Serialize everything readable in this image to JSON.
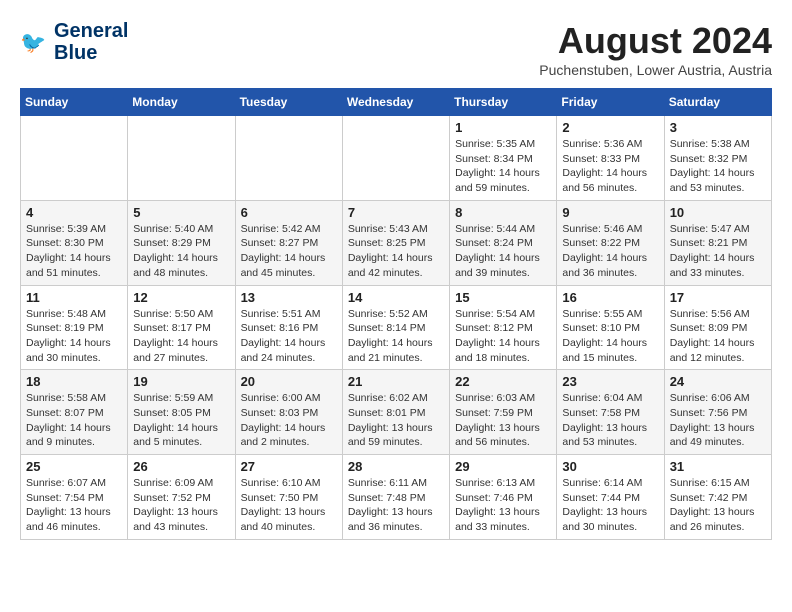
{
  "header": {
    "logo_line1": "General",
    "logo_line2": "Blue",
    "month_year": "August 2024",
    "location": "Puchenstuben, Lower Austria, Austria"
  },
  "days_of_week": [
    "Sunday",
    "Monday",
    "Tuesday",
    "Wednesday",
    "Thursday",
    "Friday",
    "Saturday"
  ],
  "weeks": [
    [
      {
        "day": "",
        "info": ""
      },
      {
        "day": "",
        "info": ""
      },
      {
        "day": "",
        "info": ""
      },
      {
        "day": "",
        "info": ""
      },
      {
        "day": "1",
        "info": "Sunrise: 5:35 AM\nSunset: 8:34 PM\nDaylight: 14 hours\nand 59 minutes."
      },
      {
        "day": "2",
        "info": "Sunrise: 5:36 AM\nSunset: 8:33 PM\nDaylight: 14 hours\nand 56 minutes."
      },
      {
        "day": "3",
        "info": "Sunrise: 5:38 AM\nSunset: 8:32 PM\nDaylight: 14 hours\nand 53 minutes."
      }
    ],
    [
      {
        "day": "4",
        "info": "Sunrise: 5:39 AM\nSunset: 8:30 PM\nDaylight: 14 hours\nand 51 minutes."
      },
      {
        "day": "5",
        "info": "Sunrise: 5:40 AM\nSunset: 8:29 PM\nDaylight: 14 hours\nand 48 minutes."
      },
      {
        "day": "6",
        "info": "Sunrise: 5:42 AM\nSunset: 8:27 PM\nDaylight: 14 hours\nand 45 minutes."
      },
      {
        "day": "7",
        "info": "Sunrise: 5:43 AM\nSunset: 8:25 PM\nDaylight: 14 hours\nand 42 minutes."
      },
      {
        "day": "8",
        "info": "Sunrise: 5:44 AM\nSunset: 8:24 PM\nDaylight: 14 hours\nand 39 minutes."
      },
      {
        "day": "9",
        "info": "Sunrise: 5:46 AM\nSunset: 8:22 PM\nDaylight: 14 hours\nand 36 minutes."
      },
      {
        "day": "10",
        "info": "Sunrise: 5:47 AM\nSunset: 8:21 PM\nDaylight: 14 hours\nand 33 minutes."
      }
    ],
    [
      {
        "day": "11",
        "info": "Sunrise: 5:48 AM\nSunset: 8:19 PM\nDaylight: 14 hours\nand 30 minutes."
      },
      {
        "day": "12",
        "info": "Sunrise: 5:50 AM\nSunset: 8:17 PM\nDaylight: 14 hours\nand 27 minutes."
      },
      {
        "day": "13",
        "info": "Sunrise: 5:51 AM\nSunset: 8:16 PM\nDaylight: 14 hours\nand 24 minutes."
      },
      {
        "day": "14",
        "info": "Sunrise: 5:52 AM\nSunset: 8:14 PM\nDaylight: 14 hours\nand 21 minutes."
      },
      {
        "day": "15",
        "info": "Sunrise: 5:54 AM\nSunset: 8:12 PM\nDaylight: 14 hours\nand 18 minutes."
      },
      {
        "day": "16",
        "info": "Sunrise: 5:55 AM\nSunset: 8:10 PM\nDaylight: 14 hours\nand 15 minutes."
      },
      {
        "day": "17",
        "info": "Sunrise: 5:56 AM\nSunset: 8:09 PM\nDaylight: 14 hours\nand 12 minutes."
      }
    ],
    [
      {
        "day": "18",
        "info": "Sunrise: 5:58 AM\nSunset: 8:07 PM\nDaylight: 14 hours\nand 9 minutes."
      },
      {
        "day": "19",
        "info": "Sunrise: 5:59 AM\nSunset: 8:05 PM\nDaylight: 14 hours\nand 5 minutes."
      },
      {
        "day": "20",
        "info": "Sunrise: 6:00 AM\nSunset: 8:03 PM\nDaylight: 14 hours\nand 2 minutes."
      },
      {
        "day": "21",
        "info": "Sunrise: 6:02 AM\nSunset: 8:01 PM\nDaylight: 13 hours\nand 59 minutes."
      },
      {
        "day": "22",
        "info": "Sunrise: 6:03 AM\nSunset: 7:59 PM\nDaylight: 13 hours\nand 56 minutes."
      },
      {
        "day": "23",
        "info": "Sunrise: 6:04 AM\nSunset: 7:58 PM\nDaylight: 13 hours\nand 53 minutes."
      },
      {
        "day": "24",
        "info": "Sunrise: 6:06 AM\nSunset: 7:56 PM\nDaylight: 13 hours\nand 49 minutes."
      }
    ],
    [
      {
        "day": "25",
        "info": "Sunrise: 6:07 AM\nSunset: 7:54 PM\nDaylight: 13 hours\nand 46 minutes."
      },
      {
        "day": "26",
        "info": "Sunrise: 6:09 AM\nSunset: 7:52 PM\nDaylight: 13 hours\nand 43 minutes."
      },
      {
        "day": "27",
        "info": "Sunrise: 6:10 AM\nSunset: 7:50 PM\nDaylight: 13 hours\nand 40 minutes."
      },
      {
        "day": "28",
        "info": "Sunrise: 6:11 AM\nSunset: 7:48 PM\nDaylight: 13 hours\nand 36 minutes."
      },
      {
        "day": "29",
        "info": "Sunrise: 6:13 AM\nSunset: 7:46 PM\nDaylight: 13 hours\nand 33 minutes."
      },
      {
        "day": "30",
        "info": "Sunrise: 6:14 AM\nSunset: 7:44 PM\nDaylight: 13 hours\nand 30 minutes."
      },
      {
        "day": "31",
        "info": "Sunrise: 6:15 AM\nSunset: 7:42 PM\nDaylight: 13 hours\nand 26 minutes."
      }
    ]
  ]
}
